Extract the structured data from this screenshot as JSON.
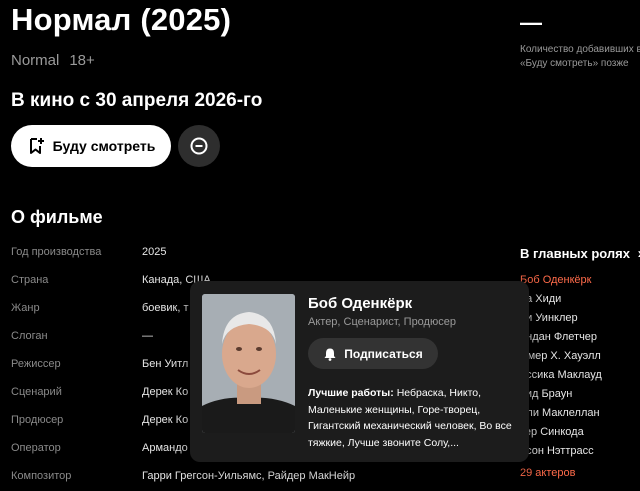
{
  "movie": {
    "title": "Нормал (2025)",
    "original_title": "Normal",
    "age_rating": "18+",
    "release": "В кино с 30 апреля 2026-го",
    "watch_button": "Буду смотреть"
  },
  "side": {
    "dash": "—",
    "note": "Количество добавивших в «Буду смотреть» позже"
  },
  "about": {
    "heading": "О фильме",
    "rows": [
      {
        "label": "Год производства",
        "value": "2025"
      },
      {
        "label": "Страна",
        "value": "Канада, США"
      },
      {
        "label": "Жанр",
        "value": "боевик, т"
      },
      {
        "label": "Слоган",
        "value": "—"
      },
      {
        "label": "Режиссер",
        "value": "Бен Уитл"
      },
      {
        "label": "Сценарий",
        "value": "Дерек Ко"
      },
      {
        "label": "Продюсер",
        "value": "Дерек Ко"
      },
      {
        "label": "Оператор",
        "value": "Армандо"
      },
      {
        "label": "Композитор",
        "value": "Гарри Грегсон-Уильямс, Райдер МакНейр"
      }
    ]
  },
  "cast": {
    "heading": "В главных ролях",
    "chevron": "›",
    "names": [
      "Боб Оденкёрк",
      "на Хиди",
      "ри Уинклер",
      "ендан Флетчер",
      "ммер Х. Хауэлл",
      "ессика Маклауд",
      "вид Браун",
      "лли Маклеллан",
      "тер Синкода",
      "рсон Нэттрасс"
    ],
    "more": "29 актеров"
  },
  "popup": {
    "name": "Боб Оденкёрк",
    "roles": "Актер, Сценарист, Продюсер",
    "subscribe": "Подписаться",
    "best_label": "Лучшие работы:",
    "best_works": "Небраска, Никто, Маленькие женщины, Горе-творец, Гигантский механический человек, Во все тяжкие, Лучше звоните Солу,..."
  },
  "colors": {
    "accent": "#ff6b4a",
    "muted": "#8a8a8a",
    "popup_bg": "#1c1c1c"
  }
}
